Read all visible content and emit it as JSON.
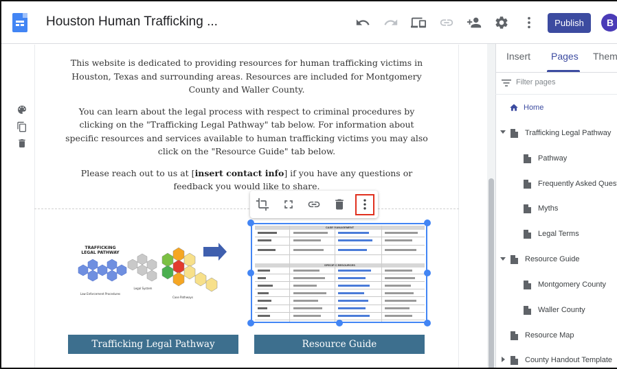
{
  "app": {
    "title": "Houston Human Trafficking ...",
    "publish_label": "Publish",
    "avatar_initial": "B",
    "accent_color": "#3c4ba0"
  },
  "toolbar_icons": [
    "undo-icon",
    "redo-icon",
    "preview-devices-icon",
    "link-icon",
    "share-add-person-icon",
    "settings-gear-icon",
    "more-vert-icon"
  ],
  "left_rail_icons": [
    "theme-palette-icon",
    "duplicate-icon",
    "delete-icon"
  ],
  "content": {
    "para1": "This website is dedicated to providing resources for human trafficking victims in Houston, Texas and surrounding areas. Resources are included for Montgomery County and Waller County.",
    "para2": "You can learn about the legal process with respect to criminal procedures by clicking on the \"Trafficking Legal Pathway\" tab below. For information about specific resources and services available to human trafficking victims you may also click on the \"Resource Guide\" tab below.",
    "para3_before": "Please reach out to us at [",
    "para3_bold": "insert contact info",
    "para3_after": "] if you have any questions or feedback you would like to share.",
    "button_left": "Trafficking Legal Pathway",
    "button_right": "Resource Guide",
    "button_color": "#3d6f8e"
  },
  "diagram": {
    "title_line1": "TRAFFICKING",
    "title_line2": "LEGAL PATHWAY",
    "label_left": "Law Enforcement Procedures",
    "label_mid": "Legal System",
    "label_right": "Case Pathways"
  },
  "resource_image": {
    "header1": "CASE MANAGEMENT",
    "header2": "SPECIFIC RESOURCES"
  },
  "image_toolbar_icons": [
    "crop-icon",
    "fullscreen-icon",
    "link-icon",
    "delete-icon",
    "more-vert-icon"
  ],
  "panel": {
    "tabs": [
      "Insert",
      "Pages",
      "Themes"
    ],
    "active_tab": "Pages",
    "filter_placeholder": "Filter pages",
    "pages": [
      {
        "label": "Home",
        "level": 0,
        "home": true
      },
      {
        "label": "Trafficking Legal Pathway",
        "level": 0,
        "expanded": true
      },
      {
        "label": "Pathway",
        "level": 1
      },
      {
        "label": "Frequently Asked Questi...",
        "level": 1
      },
      {
        "label": "Myths",
        "level": 1
      },
      {
        "label": "Legal Terms",
        "level": 1
      },
      {
        "label": "Resource Guide",
        "level": 0,
        "expanded": true
      },
      {
        "label": "Montgomery County",
        "level": 1
      },
      {
        "label": "Waller County",
        "level": 1
      },
      {
        "label": "Resource Map",
        "level": 0
      },
      {
        "label": "County Handout Template",
        "level": 0,
        "expanded": false
      }
    ]
  }
}
